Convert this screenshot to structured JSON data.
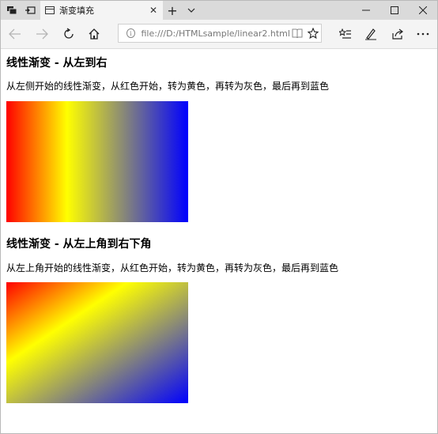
{
  "browser": {
    "tab_title": "渐变填充",
    "tab_close": "✕",
    "new_tab": "+",
    "tab_list": "⌄",
    "address_url": "file:///D:/HTMLsample/linear2.html",
    "info_glyph": "i"
  },
  "icons": {
    "tab_preview": "tab-preview-icon",
    "set_aside": "set-aside-tabs-icon",
    "back": "back-arrow-icon",
    "forward": "forward-arrow-icon",
    "refresh": "refresh-icon",
    "home": "home-icon",
    "reading_view": "reading-view-icon",
    "favorite": "star-icon",
    "favorites_hub": "favorites-list-icon",
    "notes": "pen-icon",
    "share": "share-icon",
    "more": "more-icon"
  },
  "page": {
    "section1": {
      "heading": "线性渐变 - 从左到右",
      "description": "从左侧开始的线性渐变，从红色开始，转为黄色，再转为灰色，最后再到蓝色"
    },
    "section2": {
      "heading": "线性渐变 - 从左上角到右下角",
      "description": "从左上角开始的线性渐变，从红色开始，转为黄色，再转为灰色，最后再到蓝色"
    }
  },
  "colors": {
    "gradient_stops": [
      "#ff0000",
      "#ffff00",
      "#808080",
      "#0000ff"
    ]
  }
}
